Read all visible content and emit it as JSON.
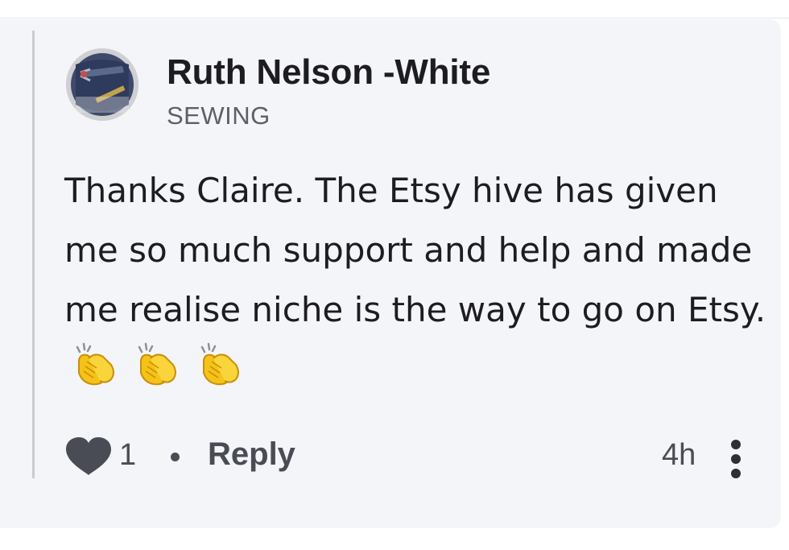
{
  "comment": {
    "author": {
      "name": "Ruth Nelson -White",
      "tag": "SEWING",
      "avatar_icon": "sewing-avatar-icon"
    },
    "body": {
      "text": "Thanks Claire. The Etsy hive has given me so much support and help and made me realise niche is the way to go on Etsy.",
      "trailing_emoji": [
        "clapping-hands",
        "clapping-hands",
        "clapping-hands"
      ]
    },
    "footer": {
      "like_icon": "heart-icon",
      "like_count": "1",
      "reply_label": "Reply",
      "timestamp": "4h",
      "more_icon": "vertical-ellipsis-icon"
    }
  },
  "colors": {
    "card_background": "#f4f5f8",
    "text_primary": "#1c1c22",
    "text_secondary": "#4a4c55",
    "thread_line": "#c9cbd1",
    "clap_emoji": "#f5c218"
  }
}
